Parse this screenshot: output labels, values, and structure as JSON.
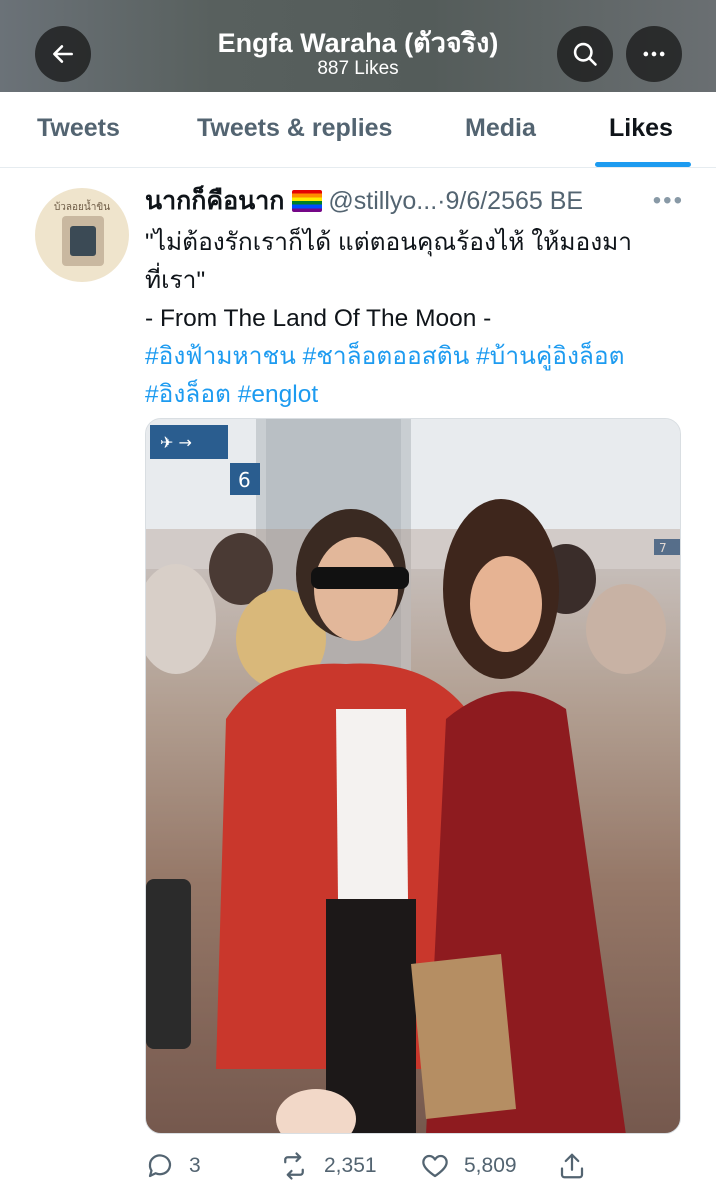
{
  "header": {
    "title": "Engfa Waraha (ตัวจริง)",
    "subtitle": "887 Likes",
    "back_icon": "arrow-left-icon",
    "search_icon": "search-icon",
    "more_icon": "more-horizontal-icon"
  },
  "tabs": [
    {
      "label": "Tweets",
      "active": false
    },
    {
      "label": "Tweets & replies",
      "active": false
    },
    {
      "label": "Media",
      "active": false
    },
    {
      "label": "Likes",
      "active": true
    }
  ],
  "tweet": {
    "author_name": "นากก็คือนาก",
    "author_badge": "rainbow-flag-icon",
    "handle": "@stillyo...",
    "separator": "·",
    "date": "9/6/2565 BE",
    "more_icon": "caret-more-icon",
    "lines": [
      "\"ไม่ต้องรักเราก็ได้ แต่ตอนคุณร้องไห้ ให้มองมา",
      "ที่เรา\"",
      "- From The Land Of The Moon -"
    ],
    "hashtags_line1": [
      "#อิงฟ้ามหาชน",
      "#ชาล็อตออสติน",
      "#บ้านคู่อิงล็อต"
    ],
    "hashtags_line2": [
      "#อิงล็อต",
      "#englot"
    ],
    "photo": {
      "sign_text_left": "",
      "sign_number": "6",
      "sign_number_right": "7"
    },
    "avatar_text": "บ้วลอยน้ำขิน"
  },
  "actions": {
    "reply_count": "3",
    "retweet_count": "2,351",
    "like_count": "5,809",
    "share_icon": "share-icon"
  },
  "colors": {
    "accent": "#1d9bf0",
    "text_primary": "#0f1419",
    "text_secondary": "#536471"
  }
}
